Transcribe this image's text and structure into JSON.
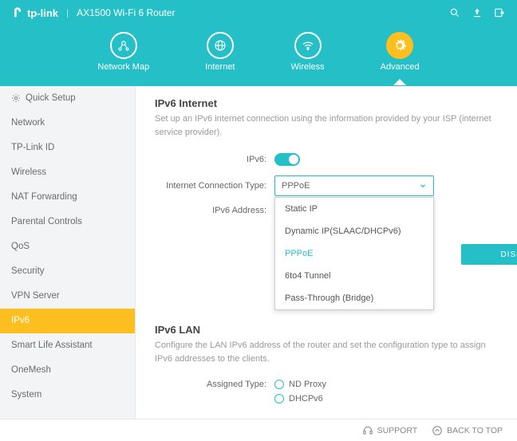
{
  "brand": "tp-link",
  "model": "AX1500 Wi-Fi 6 Router",
  "nav": {
    "map": "Network Map",
    "internet": "Internet",
    "wireless": "Wireless",
    "advanced": "Advanced"
  },
  "sidebar": {
    "quick": "Quick Setup",
    "network": "Network",
    "tplinkid": "TP-Link ID",
    "wireless": "Wireless",
    "nat": "NAT Forwarding",
    "parental": "Parental Controls",
    "qos": "QoS",
    "security": "Security",
    "vpn": "VPN Server",
    "ipv6": "IPv6",
    "sla": "Smart Life Assistant",
    "onemesh": "OneMesh",
    "system": "System"
  },
  "ipv6internet": {
    "title": "IPv6 Internet",
    "desc": "Set up an IPv6 internet connection using the information provided by your ISP (internet service provider).",
    "ipv6_label": "IPv6:",
    "conn_label": "Internet Connection Type:",
    "conn_value": "PPPoE",
    "addr_label": "IPv6 Address:",
    "options": {
      "static": "Static IP",
      "dynamic": "Dynamic IP(SLAAC/DHCPv6)",
      "pppoe": "PPPoE",
      "sixtofour": "6to4 Tunnel",
      "passthrough": "Pass-Through (Bridge)"
    },
    "disconnect": "DISCONNECT"
  },
  "ipv6lan": {
    "title": "IPv6 LAN",
    "desc": "Configure the LAN IPv6 address of the router and set the configuration type to assign IPv6 addresses to the clients.",
    "assigned_label": "Assigned Type:",
    "nd": "ND Proxy",
    "dhcp": "DHCPv6"
  },
  "footer": {
    "support": "SUPPORT",
    "back": "BACK TO TOP"
  }
}
